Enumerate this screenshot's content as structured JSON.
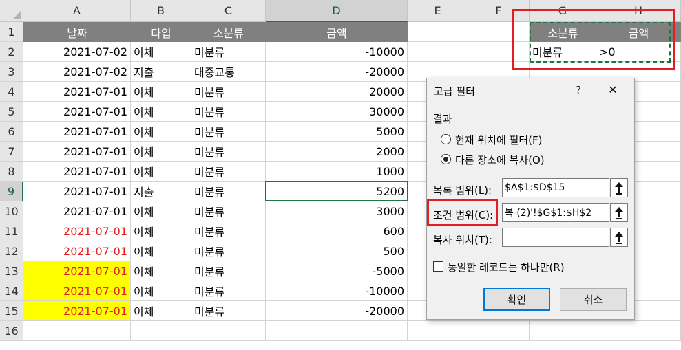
{
  "columns": [
    "A",
    "B",
    "C",
    "D",
    "E",
    "F",
    "G",
    "H"
  ],
  "rows": [
    "1",
    "2",
    "3",
    "4",
    "5",
    "6",
    "7",
    "8",
    "9",
    "10",
    "11",
    "12",
    "13",
    "14",
    "15",
    "16"
  ],
  "table": {
    "headers": {
      "date": "날짜",
      "type": "타입",
      "subcat": "소분류",
      "amount": "금액"
    },
    "data": [
      {
        "date": "2021-07-02",
        "type": "이체",
        "subcat": "미분류",
        "amount": "-10000"
      },
      {
        "date": "2021-07-02",
        "type": "지출",
        "subcat": "대중교통",
        "amount": "-20000"
      },
      {
        "date": "2021-07-01",
        "type": "이체",
        "subcat": "미분류",
        "amount": "20000"
      },
      {
        "date": "2021-07-01",
        "type": "이체",
        "subcat": "미분류",
        "amount": "30000"
      },
      {
        "date": "2021-07-01",
        "type": "이체",
        "subcat": "미분류",
        "amount": "5000"
      },
      {
        "date": "2021-07-01",
        "type": "이체",
        "subcat": "미분류",
        "amount": "2000"
      },
      {
        "date": "2021-07-01",
        "type": "이체",
        "subcat": "미분류",
        "amount": "1000"
      },
      {
        "date": "2021-07-01",
        "type": "지출",
        "subcat": "미분류",
        "amount": "5200"
      },
      {
        "date": "2021-07-01",
        "type": "이체",
        "subcat": "미분류",
        "amount": "3000"
      },
      {
        "date": "2021-07-01",
        "type": "이체",
        "subcat": "미분류",
        "amount": "600"
      },
      {
        "date": "2021-07-01",
        "type": "이체",
        "subcat": "미분류",
        "amount": "500"
      },
      {
        "date": "2021-07-01",
        "type": "이체",
        "subcat": "미분류",
        "amount": "-5000"
      },
      {
        "date": "2021-07-01",
        "type": "이체",
        "subcat": "미분류",
        "amount": "-10000"
      },
      {
        "date": "2021-07-01",
        "type": "이체",
        "subcat": "미분류",
        "amount": "-20000"
      }
    ],
    "red_date_rows": [
      11,
      12,
      13,
      14,
      15
    ],
    "yellow_date_rows": [
      13,
      14,
      15
    ]
  },
  "criteria": {
    "headers": {
      "subcat": "소분류",
      "amount": "금액"
    },
    "values": {
      "subcat": "미분류",
      "amount": ">0"
    }
  },
  "colors": {
    "header_fill": "#808080",
    "red_text": "#e02020",
    "yellow_fill": "#ffff00",
    "excel_green": "#217346",
    "highlight_red": "#e02020"
  },
  "dialog": {
    "title": "고급 필터",
    "help": "?",
    "close": "✕",
    "result_group": "결과",
    "option_filter_in_place": "현재 위치에 필터(F)",
    "option_copy_to": "다른 장소에 복사(O)",
    "selected_option": "copy_to",
    "list_range_label": "목록 범위(L):",
    "list_range_value": "$A$1:$D$15",
    "criteria_range_label": "조건 범위(C):",
    "criteria_range_value": "복 (2)'!$G$1:$H$2",
    "copy_to_label": "복사 위치(T):",
    "copy_to_value": "",
    "unique_records_label": "동일한 레코드는 하나만(R)",
    "unique_records_checked": false,
    "ok_label": "확인",
    "cancel_label": "취소",
    "ref_icon": "collapse-dialog-icon"
  }
}
